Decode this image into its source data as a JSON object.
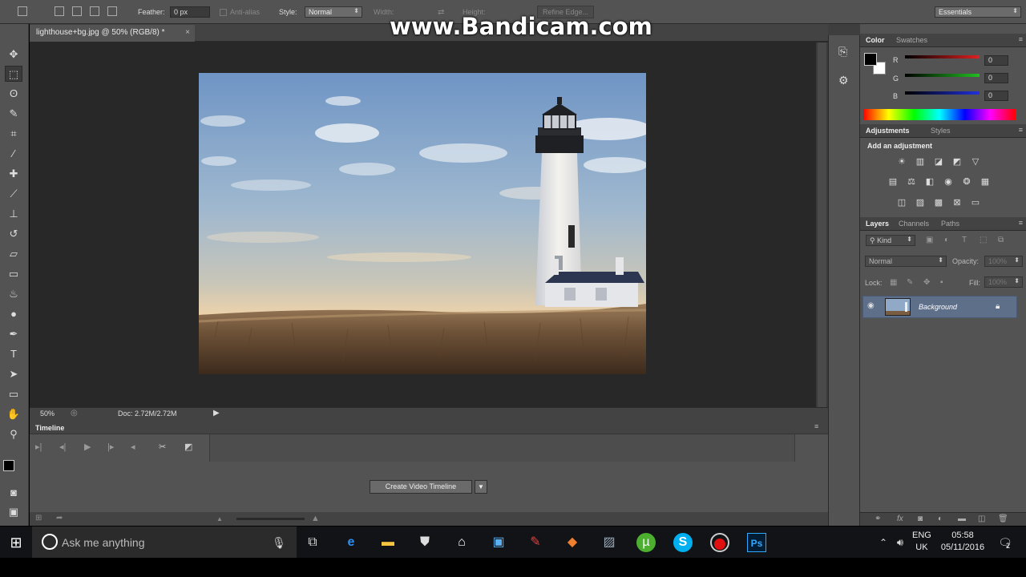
{
  "watermark": "www.Bandicam.com",
  "options_bar": {
    "feather_label": "Feather:",
    "feather_value": "0 px",
    "antialias_label": "Anti-alias",
    "style_label": "Style:",
    "style_value": "Normal",
    "width_label": "Width:",
    "height_label": "Height:",
    "refine_edge_label": "Refine Edge...",
    "workspace_value": "Essentials"
  },
  "document": {
    "tab_title": "lighthouse+bg.jpg @ 50% (RGB/8) *",
    "close_glyph": "×",
    "zoom": "50%",
    "doc_info": "Doc: 2.72M/2.72M"
  },
  "timeline": {
    "title": "Timeline",
    "create_button": "Create Video Timeline"
  },
  "color_panel": {
    "tabs": [
      "Color",
      "Swatches"
    ],
    "r_label": "R",
    "g_label": "G",
    "b_label": "B",
    "r_value": "0",
    "g_value": "0",
    "b_value": "0",
    "r_color": "#e02020",
    "g_color": "#20c020",
    "b_color": "#2030e0"
  },
  "adjustments_panel": {
    "tabs": [
      "Adjustments",
      "Styles"
    ],
    "heading": "Add an adjustment"
  },
  "layers_panel": {
    "tabs": [
      "Layers",
      "Channels",
      "Paths"
    ],
    "kind_label": "Kind",
    "blend_mode": "Normal",
    "opacity_label": "Opacity:",
    "opacity_value": "100%",
    "lock_label": "Lock:",
    "fill_label": "Fill:",
    "fill_value": "100%",
    "layers": [
      {
        "name": "Background",
        "visible": true,
        "locked": true,
        "selected": true
      }
    ]
  },
  "taskbar": {
    "search_placeholder": "Ask me anything",
    "lang_line1": "ENG",
    "lang_line2": "UK",
    "time": "05:58",
    "date": "05/11/2016",
    "notification_count": "2"
  },
  "colors": {
    "panel_bg": "#535353",
    "canvas_bg": "#282828",
    "layer_selected": "#5e6f8a"
  }
}
